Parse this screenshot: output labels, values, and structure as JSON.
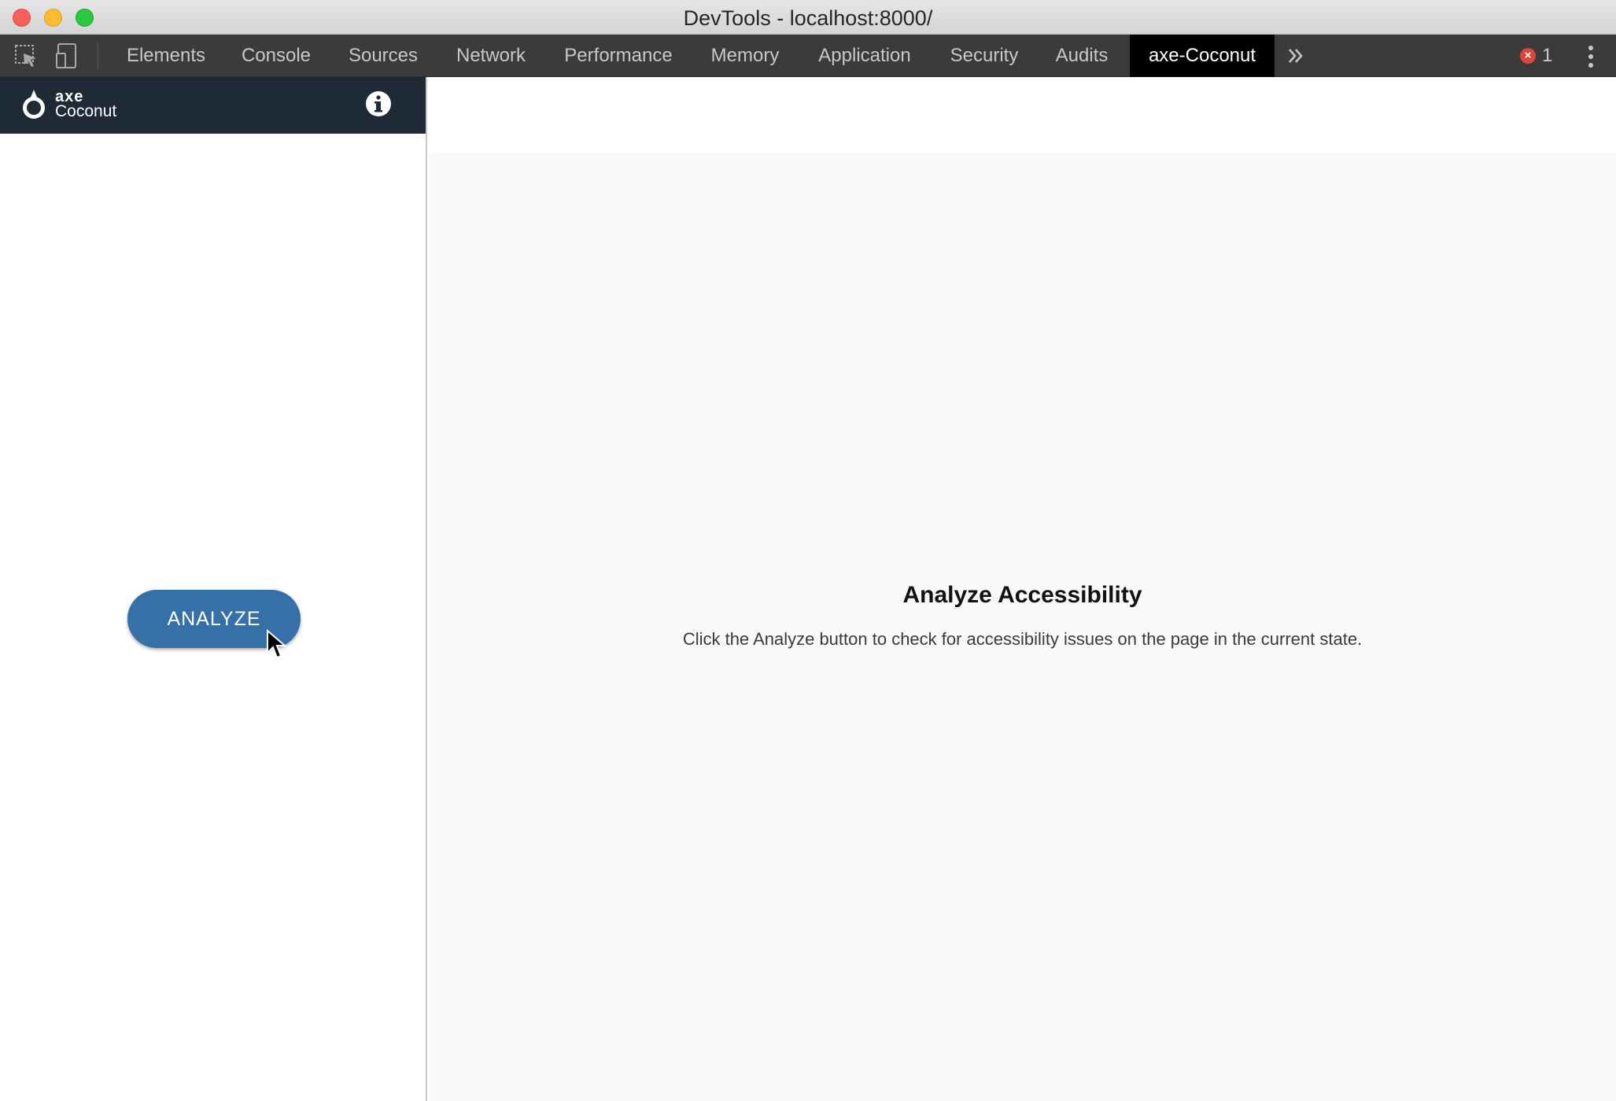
{
  "window": {
    "title": "DevTools - localhost:8000/"
  },
  "toolbar": {
    "inspect_icon": "inspect-element-icon",
    "device_icon": "device-toolbar-icon",
    "tabs": [
      {
        "label": "Elements"
      },
      {
        "label": "Console"
      },
      {
        "label": "Sources"
      },
      {
        "label": "Network"
      },
      {
        "label": "Performance"
      },
      {
        "label": "Memory"
      },
      {
        "label": "Application"
      },
      {
        "label": "Security"
      },
      {
        "label": "Audits"
      },
      {
        "label": "axe-Coconut",
        "active": true
      }
    ],
    "more_icon": "double-chevron-right-icon",
    "error_count": "1",
    "menu_icon": "vertical-ellipsis-icon"
  },
  "sidebar": {
    "brand_top": "axe",
    "brand_bottom": "Coconut",
    "info_icon": "info-icon",
    "analyze_label": "ANALYZE",
    "header_bg": "#1f2a37",
    "button_color": "#3670a8"
  },
  "main": {
    "empty_title": "Analyze Accessibility",
    "empty_description": "Click the Analyze button to check for accessibility issues on the page in the current state."
  }
}
